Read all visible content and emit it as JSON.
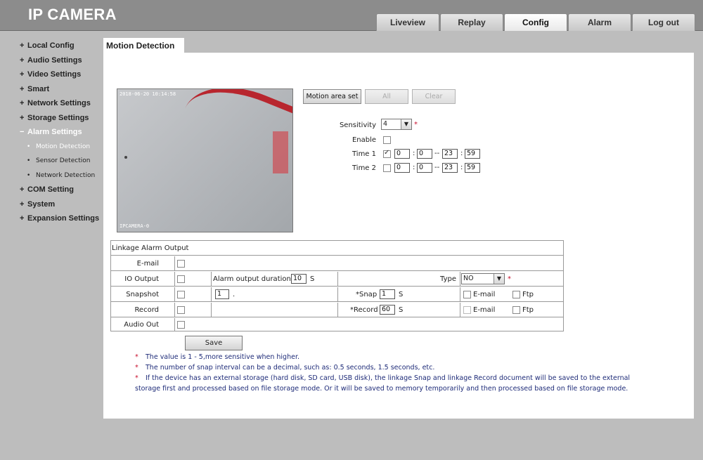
{
  "app": {
    "title": "IP CAMERA"
  },
  "topnav": [
    {
      "label": "Liveview",
      "active": false
    },
    {
      "label": "Replay",
      "active": false
    },
    {
      "label": "Config",
      "active": true
    },
    {
      "label": "Alarm",
      "active": false
    },
    {
      "label": "Log out",
      "active": false
    }
  ],
  "sidebar": {
    "local": "Local Config",
    "audio": "Audio Settings",
    "video": "Video Settings",
    "smart": "Smart",
    "network": "Network Settings",
    "storage": "Storage Settings",
    "alarm": "Alarm Settings",
    "alarm_subs": [
      "Motion Detection",
      "Sensor Detection",
      "Network Detection"
    ],
    "com": "COM Setting",
    "system": "System",
    "expansion": "Expansion Settings",
    "plus": "+",
    "minus": "−",
    "bullet": "•"
  },
  "page_title": "Motion Detection",
  "video": {
    "osd_top": "2018-06-20 10:14:58",
    "osd_bottom": "IPCAMERA-0"
  },
  "motion": {
    "area_set": "Motion area set",
    "all": "All",
    "clear": "Clear",
    "sensitivity_label": "Sensitivity",
    "sensitivity_value": "4",
    "enable_label": "Enable",
    "time1_label": "Time 1",
    "time2_label": "Time 2",
    "time1": {
      "start_h": "0",
      "start_m": "0",
      "end_h": "23",
      "end_m": "59",
      "checked": true
    },
    "time2": {
      "start_h": "0",
      "start_m": "0",
      "end_h": "23",
      "end_m": "59",
      "checked": false
    },
    "colon": ":",
    "dash": "--",
    "required": "*"
  },
  "linkage": {
    "header": "Linkage Alarm Output",
    "email": "E-mail",
    "io_output": "IO Output",
    "snapshot": "Snapshot",
    "record": "Record",
    "audio_out": "Audio Out",
    "alarm_duration_label": "Alarm output duration",
    "alarm_duration_value": "10",
    "unit_s": "S",
    "type_label": "Type",
    "type_value": "NO",
    "snapshot_count": "1",
    "period": ".",
    "snap_label": "*Snap",
    "snap_value": "1",
    "record_label": "*Record",
    "record_value": "60",
    "email_opt": "E-mail",
    "ftp_opt": "Ftp"
  },
  "save_label": "Save",
  "notes": {
    "star": "*",
    "n1": "The value is 1 - 5,more sensitive when higher.",
    "n2": "The number of snap interval can be a decimal, such as: 0.5 seconds, 1.5 seconds, etc.",
    "n3a": "If the device has an external storage (hard disk, SD card, USB disk), the linkage Snap and linkage Record document will be saved to the external",
    "n3b": "storage first and processed based on file storage mode. Or it will be saved to memory temporarily and then processed based on file storage mode."
  },
  "colors": {
    "header": "#8c8c8c",
    "background": "#bdbdbd",
    "note_text": "#1e2b78",
    "required": "#c8102e"
  }
}
